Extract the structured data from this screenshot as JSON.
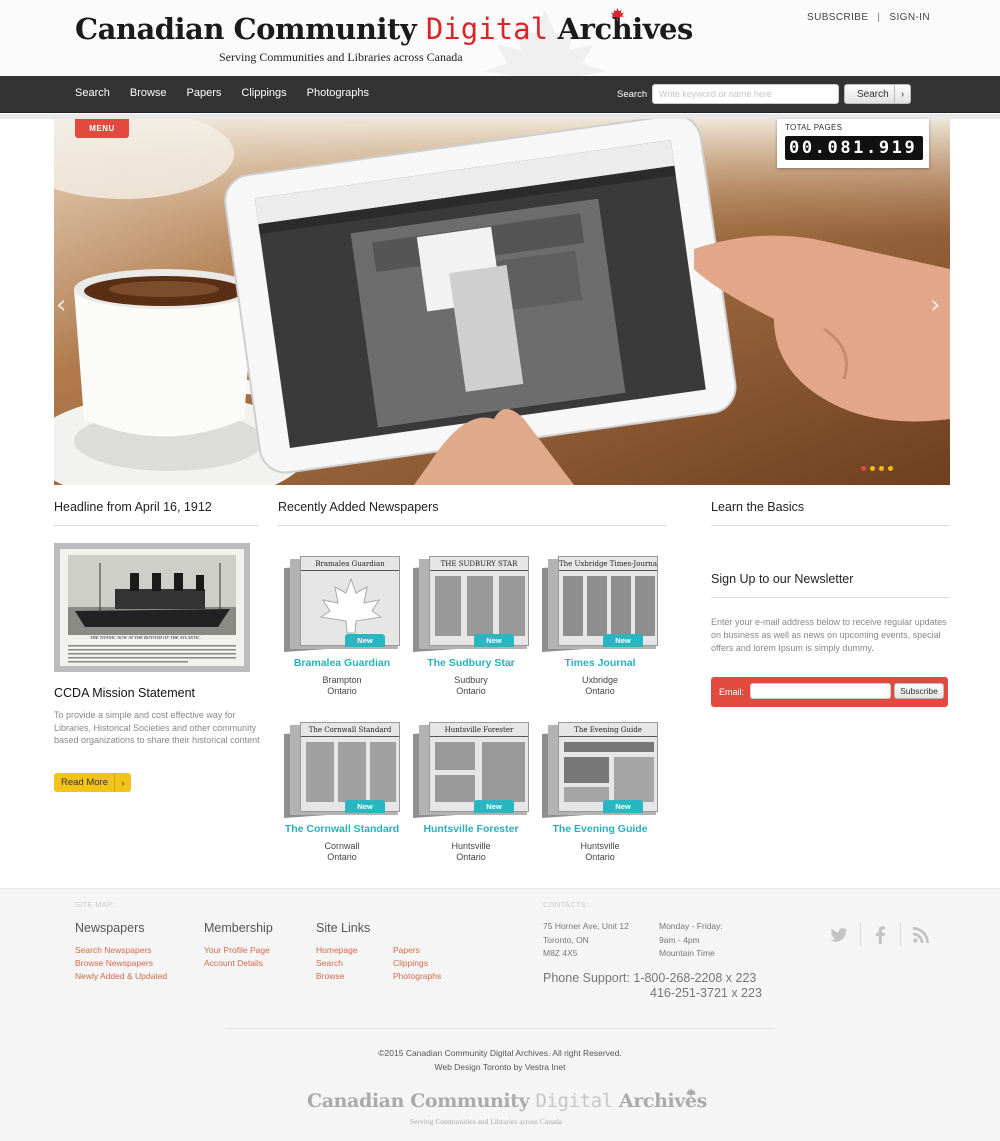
{
  "header": {
    "logo": {
      "part1": "Canadian Community ",
      "part2": "Digital",
      "part3": " Archives"
    },
    "tagline": "Serving Communities and Libraries across Canada",
    "top_links": {
      "subscribe": "SUBSCRIBE",
      "separator": "|",
      "signin": "SIGN-IN"
    }
  },
  "nav": {
    "items": [
      "Search",
      "Browse",
      "Papers",
      "Clippings",
      "Photographs"
    ],
    "search_label": "Search",
    "search_placeholder": "Write keyword or name here",
    "search_button": "Search"
  },
  "hero": {
    "menu_label": "MENU",
    "counter_label": "TOTAL PAGES",
    "counter_value": "00.081.919",
    "slides": 4,
    "active_slide": 1
  },
  "left": {
    "headline_title": "Headline from April 16, 1912",
    "headline_caption": "THE TITANIC NOW AT THE BOTTOM OF THE ATLANTIC.",
    "mission_title": "CCDA Mission Statement",
    "mission_text": "To provide a simple and cost effective way for Libraries, Historical Societies and other community based organizations to share their historical content",
    "read_more": "Read More"
  },
  "recent": {
    "title": "Recently Added Newspapers",
    "badge": "New",
    "papers": [
      {
        "name": "Bramalea Guardian",
        "city": "Brampton",
        "province": "Ontario",
        "masthead": "Bramalea Guardian"
      },
      {
        "name": "The Sudbury Star",
        "city": "Sudbury",
        "province": "Ontario",
        "masthead": "THE SUDBURY STAR"
      },
      {
        "name": "Times Journal",
        "city": "Uxbridge",
        "province": "Ontario",
        "masthead": "The Uxbridge Times-Journal"
      },
      {
        "name": "The Cornwall Standard",
        "city": "Cornwall",
        "province": "Ontario",
        "masthead": "The Cornwall Standard"
      },
      {
        "name": "Huntsville Forester",
        "city": "Huntsville",
        "province": "Ontario",
        "masthead": "Huntsville Forester"
      },
      {
        "name": "The Evening Guide",
        "city": "Huntsville",
        "province": "Ontario",
        "masthead": "The Evening Guide"
      }
    ]
  },
  "right": {
    "basics_title": "Learn the Basics",
    "newsletter_title": "Sign Up to our Newsletter",
    "newsletter_text": "Enter your e-mail address below to receive regular updates on business as well as news on upcoming events, special offers and lorem Ipsum is simply dummy.",
    "email_label": "Email:",
    "subscribe_button": "Subscribe"
  },
  "footer": {
    "sitemap_label": "SITE MAP:",
    "newspapers": {
      "title": "Newspapers",
      "links": [
        "Search Newspapers",
        "Browse Newspapers",
        "Newly Added & Updated"
      ]
    },
    "membership": {
      "title": "Membership",
      "links": [
        "Your Profile Page",
        "Account Details"
      ]
    },
    "sitelinks": {
      "title": "Site Links",
      "col1": [
        "Homepage",
        "Search",
        "Browse"
      ],
      "col2": [
        "Papers",
        "Clippings",
        "Photographs"
      ]
    },
    "contacts_label": "CONTACTS:",
    "address": [
      "75 Horner Ave, Unit 12",
      "Toronto, ON",
      "M8Z 4X5"
    ],
    "hours": [
      "Monday - Friday:",
      "9am - 4pm",
      "Mountain Time"
    ],
    "phone_line1": "Phone Support: 1-800-268-2208 x 223",
    "phone_line2": "416-251-3721 x 223",
    "social_icons": [
      "twitter-icon",
      "facebook-icon",
      "rss-icon"
    ],
    "copyright": "©2015 Canadian Community Digital Archives. All right Reserved.",
    "credit": "Web Design Toronto by Vestra Inet",
    "logo": {
      "part1": "Canadian Community ",
      "part2": "Digital",
      "part3": " Archives"
    },
    "tagline": "Serving Communities and Libraries across Canada"
  },
  "colors": {
    "accent_red": "#e24a3f",
    "teal": "#2ab6c1",
    "yellow": "#f2c318",
    "nav_bg": "#333333"
  }
}
